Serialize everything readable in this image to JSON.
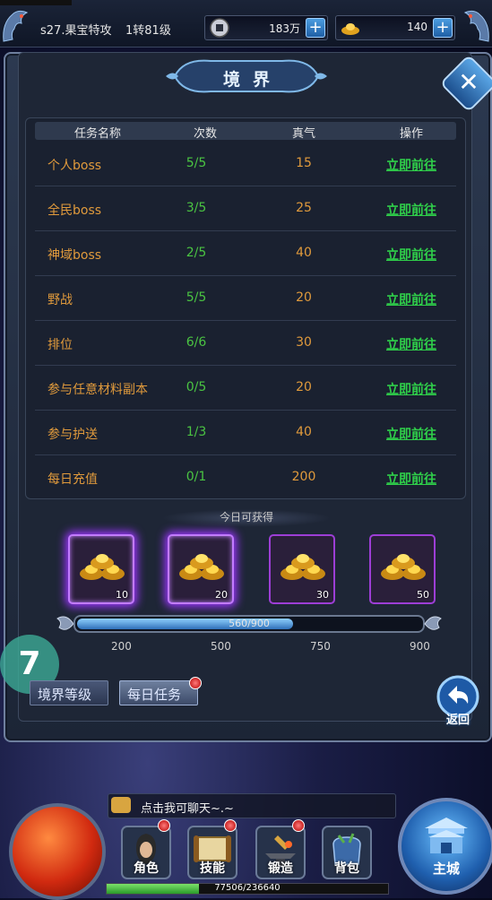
{
  "topbar": {
    "server": "s27.果宝特攻",
    "level": "1转81级",
    "coins": "183万",
    "gold": "140",
    "plus": "+"
  },
  "panel": {
    "title": "境界",
    "close": "✕"
  },
  "table": {
    "headers": [
      "任务名称",
      "次数",
      "真气",
      "操作"
    ],
    "rows": [
      {
        "name": "个人boss",
        "count": "5/5",
        "qi": "15",
        "op": "立即前往"
      },
      {
        "name": "全民boss",
        "count": "3/5",
        "qi": "25",
        "op": "立即前往"
      },
      {
        "name": "神域boss",
        "count": "2/5",
        "qi": "40",
        "op": "立即前往"
      },
      {
        "name": "野战",
        "count": "5/5",
        "qi": "20",
        "op": "立即前往"
      },
      {
        "name": "排位",
        "count": "6/6",
        "qi": "30",
        "op": "立即前往"
      },
      {
        "name": "参与任意材料副本",
        "count": "0/5",
        "qi": "20",
        "op": "立即前往"
      },
      {
        "name": "参与护送",
        "count": "1/3",
        "qi": "40",
        "op": "立即前往"
      },
      {
        "name": "每日充值",
        "count": "0/1",
        "qi": "200",
        "op": "立即前往"
      }
    ]
  },
  "rewards": {
    "label": "今日可获得",
    "chests": [
      "10",
      "20",
      "30",
      "50"
    ],
    "progress_text": "560/900",
    "progress_fraction": 0.622,
    "milestones": [
      "200",
      "500",
      "750",
      "900"
    ]
  },
  "tabs": {
    "realm_level": "境界等级",
    "daily_task": "每日任务"
  },
  "misc": {
    "seven": "7",
    "back": "返回"
  },
  "hud": {
    "chat": "点击我可聊天~.~",
    "buttons": [
      "角色",
      "技能",
      "锻造",
      "背包"
    ],
    "city": "主城",
    "xp_text": "77506/236640",
    "xp_fraction": 0.3275
  }
}
